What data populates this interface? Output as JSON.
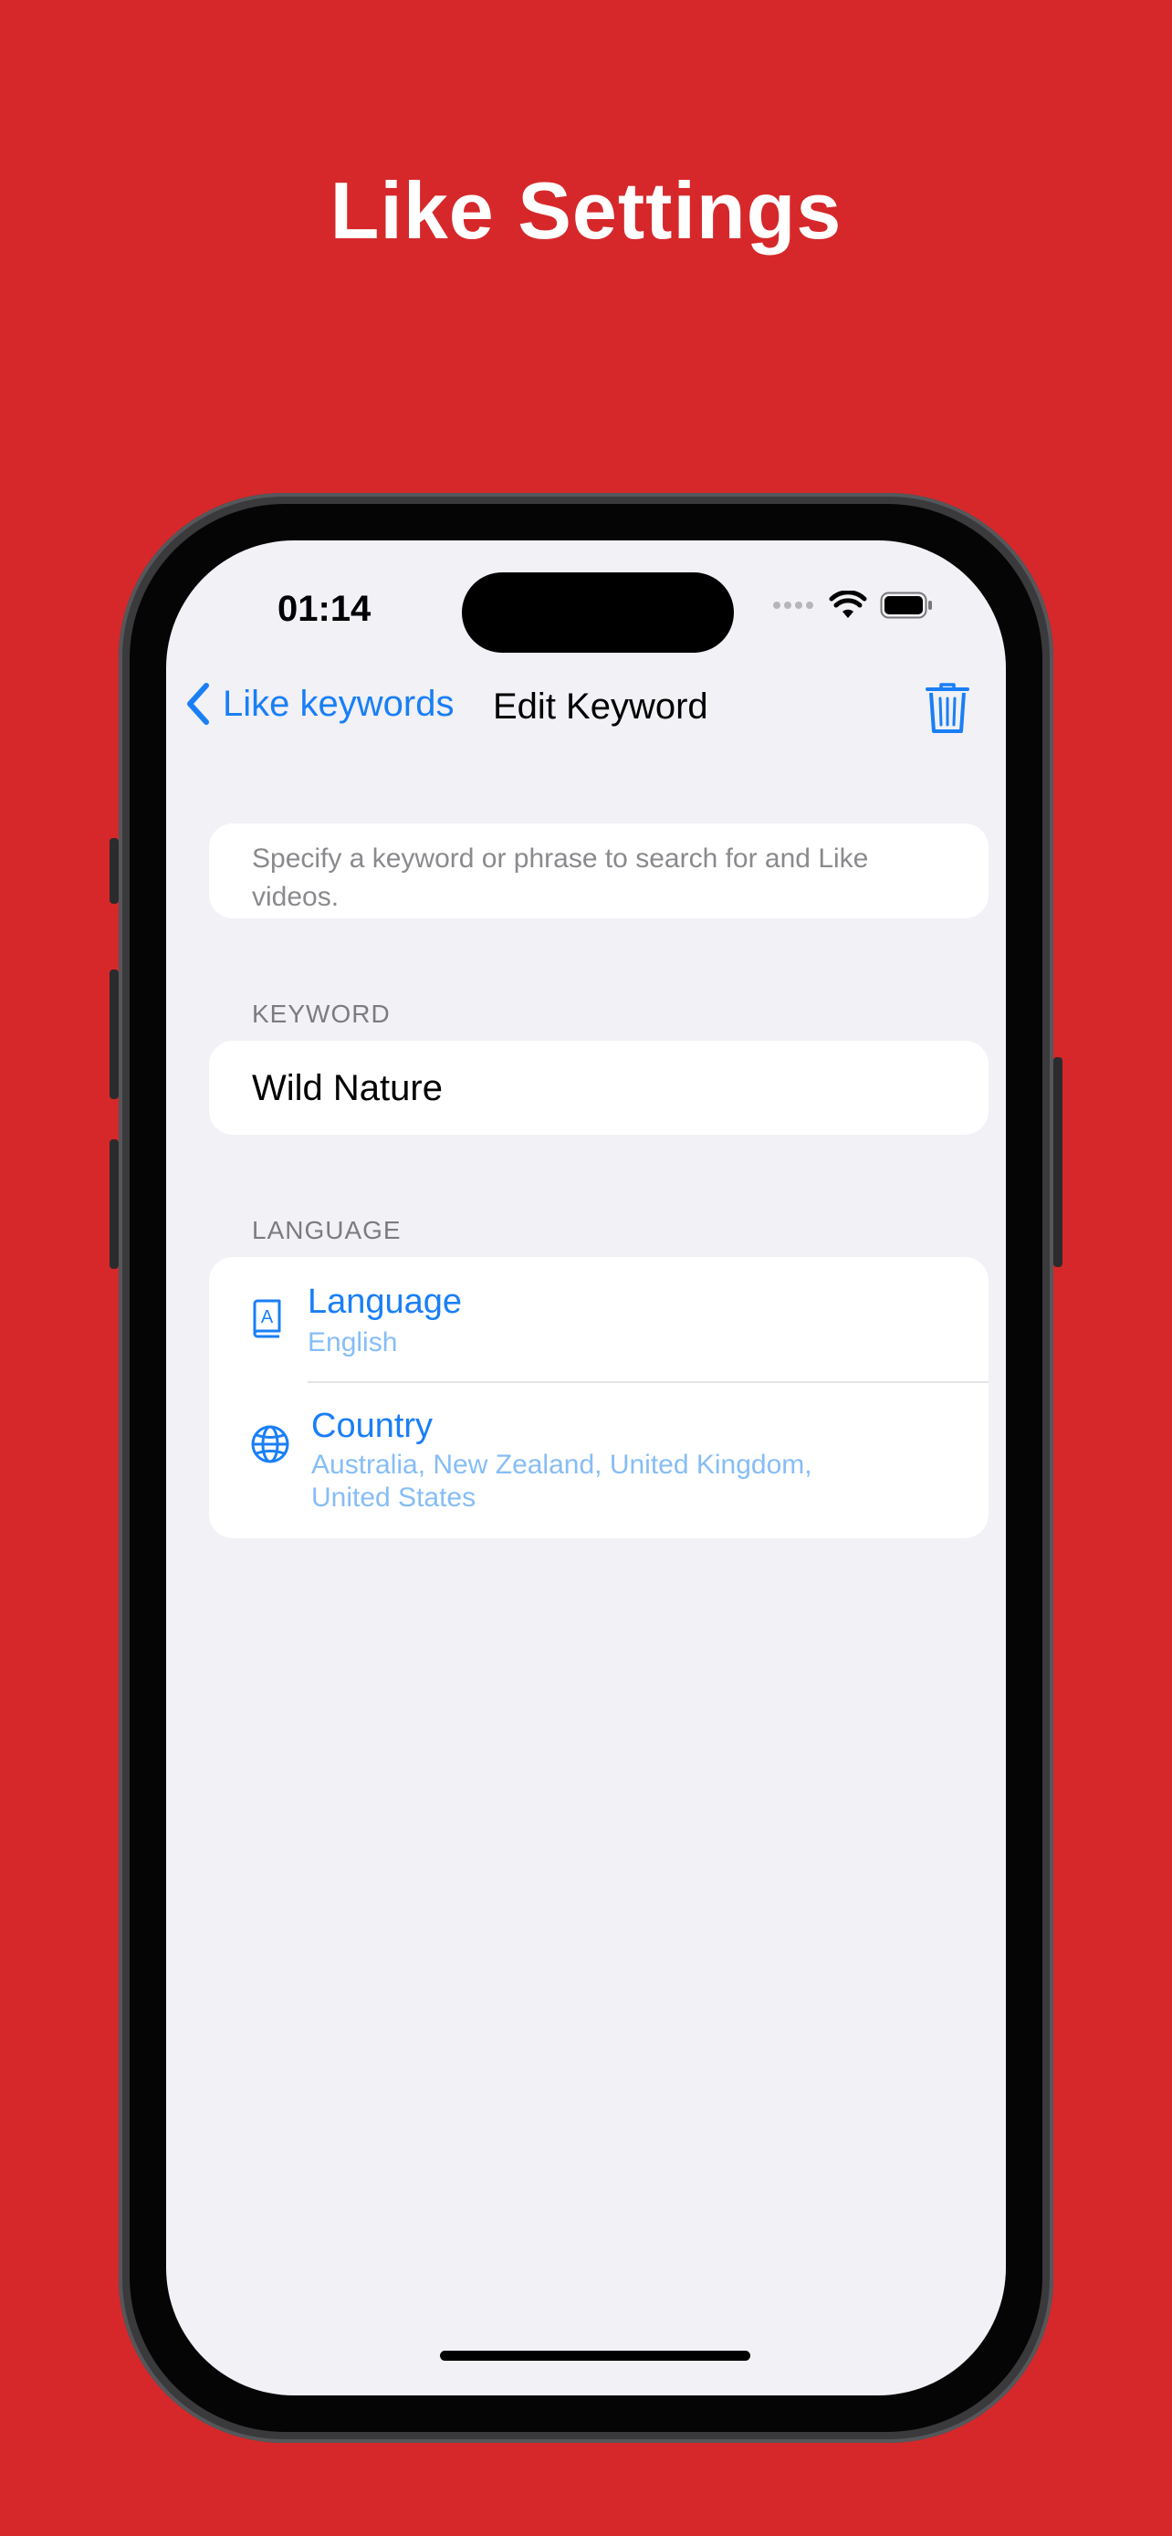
{
  "headline": "Like Settings",
  "status_bar": {
    "time": "01:14"
  },
  "nav": {
    "back_label": "Like keywords",
    "title": "Edit Keyword"
  },
  "info": {
    "text": "Specify a keyword or phrase to search for and Like videos."
  },
  "keyword_section": {
    "header": "KEYWORD",
    "value": "Wild Nature"
  },
  "language_section": {
    "header": "LANGUAGE",
    "rows": [
      {
        "title": "Language",
        "subtitle": "English",
        "icon": "book-icon"
      },
      {
        "title": "Country",
        "subtitle": "Australia, New Zealand, United Kingdom, United States",
        "icon": "globe-icon"
      }
    ]
  },
  "colors": {
    "background": "#d6282a",
    "accent": "#1a7ff5",
    "screen": "#f1f1f6"
  }
}
